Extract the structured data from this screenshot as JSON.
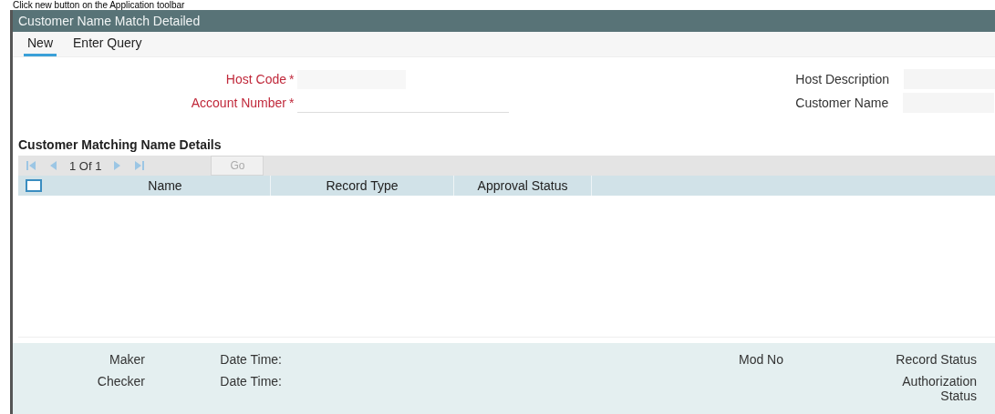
{
  "caption": "Click new button on the Application toolbar",
  "window": {
    "title": "Customer Name Match Detailed"
  },
  "toolbar": [
    {
      "label": "New",
      "selected": true
    },
    {
      "label": "Enter Query",
      "selected": false
    }
  ],
  "form": {
    "left": [
      {
        "label": "Host Code",
        "required_mark": "*",
        "kind": "shaded"
      },
      {
        "label": "Account Number",
        "required_mark": "*",
        "kind": "underline"
      }
    ],
    "right": [
      {
        "label": "Host Description"
      },
      {
        "label": "Customer Name"
      }
    ]
  },
  "section": {
    "title": "Customer Matching Name Details"
  },
  "pager": {
    "text": "1 Of 1",
    "go": "Go"
  },
  "table": {
    "select_all": {
      "checked": false
    },
    "columns": [
      "Name",
      "Record Type",
      "Approval Status"
    ]
  },
  "footer": [
    {
      "label": "Maker",
      "label2": "Date Time:",
      "label3": "Mod No",
      "label4": "Record Status"
    },
    {
      "label": "Checker",
      "label2": "Date Time:",
      "label4": "Authorization Status"
    }
  ]
}
